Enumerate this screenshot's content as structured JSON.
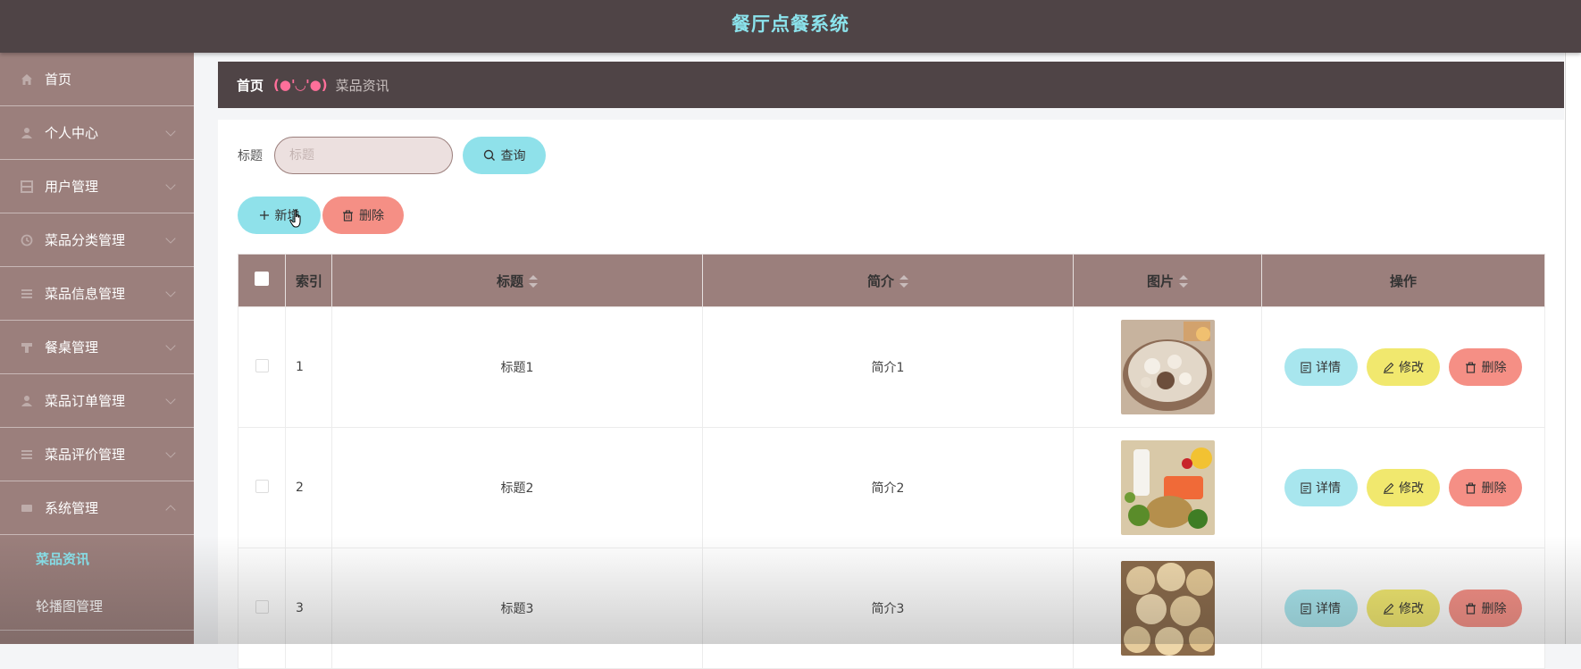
{
  "app": {
    "title": "餐厅点餐系统"
  },
  "sidebar": {
    "items": [
      {
        "label": "首页",
        "icon": "home-icon"
      },
      {
        "label": "个人中心",
        "icon": "user-icon"
      },
      {
        "label": "用户管理",
        "icon": "grid-icon"
      },
      {
        "label": "菜品分类管理",
        "icon": "clock-icon"
      },
      {
        "label": "菜品信息管理",
        "icon": "list-icon"
      },
      {
        "label": "餐桌管理",
        "icon": "table-icon"
      },
      {
        "label": "菜品订单管理",
        "icon": "user-icon"
      },
      {
        "label": "菜品评价管理",
        "icon": "list-icon"
      },
      {
        "label": "系统管理",
        "icon": "system-icon",
        "expanded": true
      }
    ],
    "subitems": [
      {
        "label": "菜品资讯",
        "active": true
      },
      {
        "label": "轮播图管理",
        "active": false
      }
    ]
  },
  "breadcrumb": {
    "home": "首页",
    "separator": "(●'◡'●)",
    "current": "菜品资讯"
  },
  "search": {
    "label": "标题",
    "placeholder": "标题",
    "query_label": "查询"
  },
  "actions": {
    "add_label": "新增",
    "delete_label": "删除"
  },
  "table": {
    "columns": [
      "索引",
      "标题",
      "简介",
      "图片",
      "操作"
    ],
    "rows": [
      {
        "index": "1",
        "title": "标题1",
        "intro": "简介1",
        "image": "hotpot-dish-photo"
      },
      {
        "index": "2",
        "title": "标题2",
        "intro": "简介2",
        "image": "healthy-food-photo"
      },
      {
        "index": "3",
        "title": "标题3",
        "intro": "简介3",
        "image": "pastry-photo"
      }
    ],
    "row_actions": {
      "detail": "详情",
      "edit": "修改",
      "delete": "删除"
    }
  },
  "colors": {
    "header_bg": "#4f4446",
    "title": "#8be3ec",
    "sidebar_bg": "#9b7f7c",
    "accent_cyan": "#8fe1ea",
    "accent_yellow": "#f1e86e",
    "accent_red": "#f58f85",
    "breadcrumb_sep": "#ff6f9a"
  }
}
